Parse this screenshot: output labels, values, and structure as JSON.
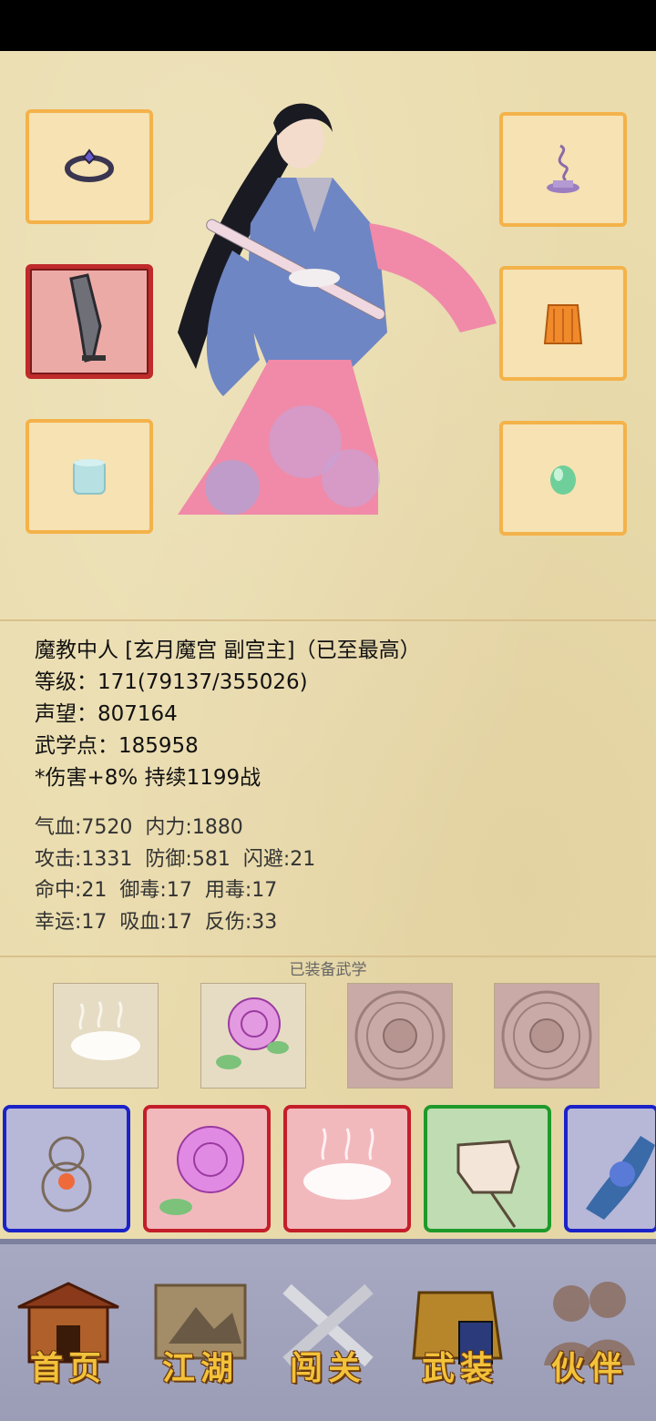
{
  "character": {
    "title_line": "魔教中人 [玄月魔宫 副宫主]（已至最高）",
    "level": "等级：171(79137/355026)",
    "prestige": "声望：807164",
    "martial_points": "武学点：185958",
    "buff": "*伤害+8% 持续1199战"
  },
  "stats": {
    "row1": [
      "气血:7520",
      "内力:1880"
    ],
    "row2": [
      "攻击:1331",
      "防御:581",
      "闪避:21"
    ],
    "row3": [
      "命中:21",
      "御毒:17",
      "用毒:17"
    ],
    "row4": [
      "幸运:17",
      "吸血:17",
      "反伤:33"
    ]
  },
  "equipped_martial_title": "已装备武学",
  "equipment_slots": [
    "ring-icon",
    "incense-icon",
    "broadsword-icon",
    "armor-icon",
    "bracer-icon",
    "jade-icon"
  ],
  "martial_slots": [
    "mist-icon",
    "rose-icon",
    "locked-slot-icon",
    "locked-slot-icon"
  ],
  "skills": [
    {
      "icon": "gourd-icon",
      "border": "#1b22c8",
      "bg": "#b7b7d8"
    },
    {
      "icon": "rose-icon",
      "border": "#c41e2a",
      "bg": "#f2b9bd"
    },
    {
      "icon": "mist-icon",
      "border": "#c41e2a",
      "bg": "#f2b9bd"
    },
    {
      "icon": "fist-icon",
      "border": "#1e9a2a",
      "bg": "#bfdcb2"
    },
    {
      "icon": "hand-icon",
      "border": "#1b22c8",
      "bg": "#b7b7d8"
    }
  ],
  "nav": {
    "home": "首页",
    "jianghu": "江湖",
    "challenge": "闯关",
    "gear": "武装",
    "partner": "伙伴"
  }
}
